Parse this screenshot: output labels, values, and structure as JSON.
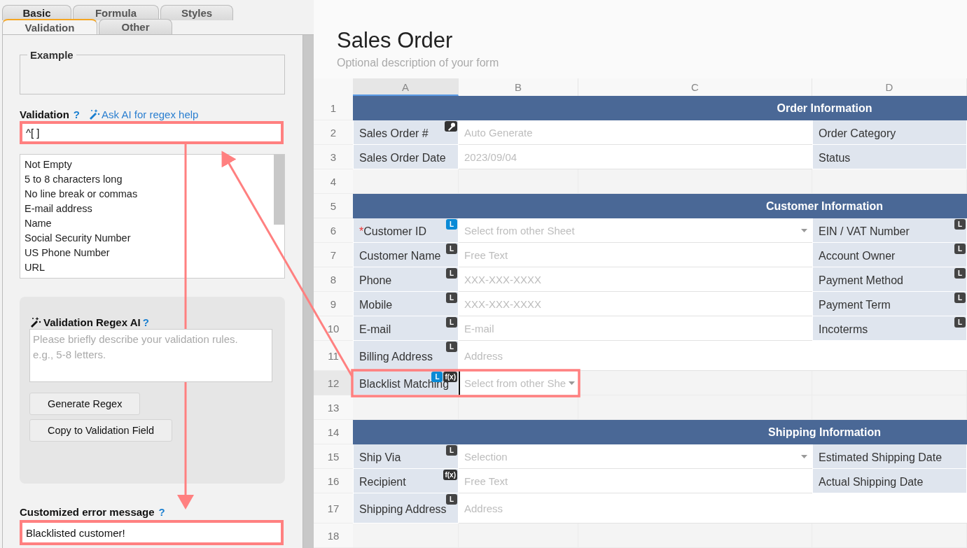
{
  "panel": {
    "tab_rows": [
      [
        {
          "label": "Basic",
          "selected": false
        },
        {
          "label": "Formula",
          "selected": false
        },
        {
          "label": "Styles",
          "selected": false
        }
      ],
      [
        {
          "label": "Validation",
          "selected": true
        },
        {
          "label": "Other",
          "selected": false
        }
      ]
    ],
    "example": {
      "legend": "Example"
    },
    "validation": {
      "label": "Validation",
      "help": "?",
      "ai_link": "Ask AI for regex help",
      "value": "^[ ]",
      "highlighted": true
    },
    "presets": [
      "Not Empty",
      "5 to 8 characters long",
      "No line break or commas",
      "E-mail address",
      "Name",
      "Social Security Number",
      "US Phone Number",
      "URL"
    ],
    "ai_box": {
      "title": "Validation Regex AI",
      "help": "?",
      "placeholder": "Please briefly describe your validation rules.\ne.g., 5-8 letters.",
      "buttons": [
        "Generate Regex",
        "Copy to Validation Field"
      ]
    },
    "error_message": {
      "label": "Customized error message",
      "help": "?",
      "value": "Blacklisted customer!",
      "highlighted": true
    }
  },
  "form": {
    "title": "Sales Order",
    "description": "Optional description of your form"
  },
  "sheet": {
    "columns": [
      {
        "label": "A",
        "selected": true
      },
      {
        "label": "B",
        "selected": false
      },
      {
        "label": "C",
        "selected": false
      },
      {
        "label": "D",
        "selected": false
      }
    ],
    "rows": [
      {
        "number": "1",
        "selected": false,
        "kind": "section",
        "title": "Order Information"
      },
      {
        "number": "2",
        "selected": false,
        "kind": "fields",
        "cells": [
          {
            "kind": "label",
            "text": "Sales Order #",
            "badges": [
              {
                "kind": "key",
                "color": "#333333"
              }
            ]
          },
          {
            "kind": "field",
            "text": "Auto Generate"
          },
          {
            "kind": "label",
            "text": "Order Category"
          }
        ]
      },
      {
        "number": "3",
        "selected": false,
        "kind": "fields",
        "cells": [
          {
            "kind": "label",
            "text": "Sales Order Date"
          },
          {
            "kind": "field",
            "text": "2023/09/04"
          },
          {
            "kind": "label",
            "text": "Status"
          }
        ]
      },
      {
        "number": "4",
        "selected": false,
        "kind": "fields",
        "cells": [
          {
            "kind": "empty"
          },
          {
            "kind": "empty"
          },
          {
            "kind": "empty"
          },
          {
            "kind": "empty"
          }
        ]
      },
      {
        "number": "5",
        "selected": false,
        "kind": "section",
        "title": "Customer Information"
      },
      {
        "number": "6",
        "selected": false,
        "kind": "fields",
        "cells": [
          {
            "kind": "label",
            "required_mark": "*",
            "text": "Customer ID",
            "badges": [
              {
                "kind": "text",
                "text": "L",
                "color": "#0a8ad6"
              }
            ]
          },
          {
            "kind": "field",
            "text": "Select from other Sheet",
            "dropdown": true
          },
          {
            "kind": "label",
            "text": "EIN / VAT Number",
            "badges": [
              {
                "kind": "text",
                "text": "L",
                "color": "#444444"
              }
            ]
          }
        ]
      },
      {
        "number": "7",
        "selected": false,
        "kind": "fields",
        "cells": [
          {
            "kind": "label",
            "text": "Customer Name",
            "badges": [
              {
                "kind": "text",
                "text": "L",
                "color": "#444444"
              }
            ]
          },
          {
            "kind": "field",
            "text": "Free Text"
          },
          {
            "kind": "label",
            "text": "Account Owner",
            "badges": [
              {
                "kind": "text",
                "text": "L",
                "color": "#444444"
              }
            ]
          }
        ]
      },
      {
        "number": "8",
        "selected": false,
        "kind": "fields",
        "cells": [
          {
            "kind": "label",
            "text": "Phone",
            "badges": [
              {
                "kind": "text",
                "text": "L",
                "color": "#444444"
              }
            ]
          },
          {
            "kind": "field",
            "text": "XXX-XXX-XXXX"
          },
          {
            "kind": "label",
            "text": "Payment Method",
            "badges": [
              {
                "kind": "text",
                "text": "L",
                "color": "#444444"
              }
            ]
          }
        ]
      },
      {
        "number": "9",
        "selected": false,
        "kind": "fields",
        "cells": [
          {
            "kind": "label",
            "text": "Mobile",
            "badges": [
              {
                "kind": "text",
                "text": "L",
                "color": "#444444"
              }
            ]
          },
          {
            "kind": "field",
            "text": "XXX-XXX-XXXX"
          },
          {
            "kind": "label",
            "text": "Payment Term",
            "badges": [
              {
                "kind": "text",
                "text": "L",
                "color": "#444444"
              }
            ]
          }
        ]
      },
      {
        "number": "10",
        "selected": false,
        "kind": "fields",
        "cells": [
          {
            "kind": "label",
            "text": "E-mail",
            "badges": [
              {
                "kind": "text",
                "text": "L",
                "color": "#444444"
              }
            ]
          },
          {
            "kind": "field",
            "text": "E-mail"
          },
          {
            "kind": "label",
            "text": "Incoterms",
            "badges": [
              {
                "kind": "text",
                "text": "L",
                "color": "#444444"
              }
            ]
          }
        ]
      },
      {
        "number": "11",
        "selected": false,
        "tall": true,
        "kind": "fields",
        "cells": [
          {
            "kind": "label",
            "text": "Billing Address",
            "badges": [
              {
                "kind": "text",
                "text": "L",
                "color": "#444444"
              }
            ]
          },
          {
            "kind": "wide",
            "text": "Address"
          }
        ]
      },
      {
        "number": "12",
        "selected": true,
        "kind": "fields",
        "cells": [
          {
            "kind": "label",
            "text": "Blacklist Matching",
            "highlighted": true,
            "badges": [
              {
                "kind": "text",
                "text": "L",
                "color": "#0a8ad6"
              },
              {
                "kind": "text",
                "text": "f(x)",
                "color": "#333333"
              }
            ]
          },
          {
            "kind": "value",
            "text": "Select from other She",
            "dropdown": true,
            "active": true,
            "highlighted": true
          },
          {
            "kind": "empty"
          },
          {
            "kind": "empty"
          }
        ]
      },
      {
        "number": "13",
        "selected": false,
        "kind": "fields",
        "cells": [
          {
            "kind": "empty"
          },
          {
            "kind": "empty"
          },
          {
            "kind": "empty"
          },
          {
            "kind": "empty"
          }
        ]
      },
      {
        "number": "14",
        "selected": false,
        "kind": "section",
        "title": "Shipping Information"
      },
      {
        "number": "15",
        "selected": false,
        "kind": "fields",
        "cells": [
          {
            "kind": "label",
            "text": "Ship Via",
            "badges": [
              {
                "kind": "text",
                "text": "L",
                "color": "#444444"
              }
            ]
          },
          {
            "kind": "field",
            "text": "Selection",
            "dropdown": true
          },
          {
            "kind": "label",
            "text": "Estimated Shipping Date"
          }
        ]
      },
      {
        "number": "16",
        "selected": false,
        "kind": "fields",
        "cells": [
          {
            "kind": "label",
            "text": "Recipient",
            "badges": [
              {
                "kind": "text",
                "text": "f(x)",
                "color": "#333333"
              }
            ]
          },
          {
            "kind": "field",
            "text": "Free Text"
          },
          {
            "kind": "label",
            "text": "Actual Shipping Date"
          }
        ]
      },
      {
        "number": "17",
        "selected": false,
        "tall": true,
        "kind": "fields",
        "cells": [
          {
            "kind": "label",
            "text": "Shipping Address",
            "badges": [
              {
                "kind": "text",
                "text": "L",
                "color": "#444444"
              }
            ]
          },
          {
            "kind": "wide",
            "text": "Address"
          }
        ]
      },
      {
        "number": "18",
        "selected": false,
        "kind": "fields",
        "cells": [
          {
            "kind": "empty"
          },
          {
            "kind": "empty"
          },
          {
            "kind": "empty"
          },
          {
            "kind": "empty"
          }
        ]
      }
    ]
  }
}
